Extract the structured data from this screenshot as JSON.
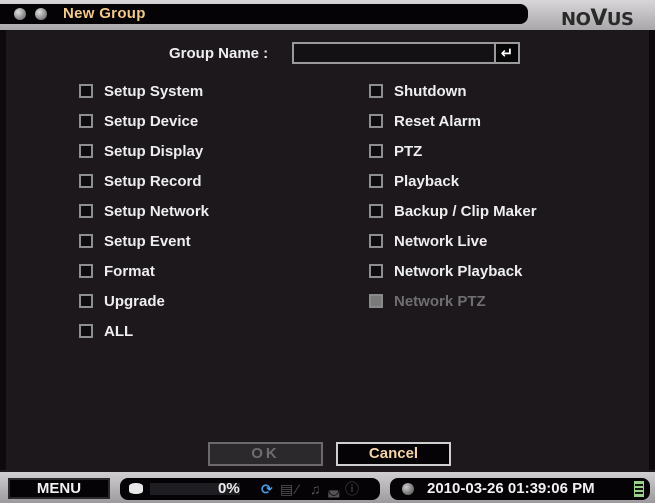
{
  "window": {
    "title": "New Group",
    "brand": "NOVUS"
  },
  "form": {
    "group_name_label": "Group Name :",
    "group_name_value": "",
    "enter_symbol": "↵"
  },
  "permissions": {
    "left": [
      {
        "label": "Setup System",
        "checked": false,
        "enabled": true
      },
      {
        "label": "Setup Device",
        "checked": false,
        "enabled": true
      },
      {
        "label": "Setup Display",
        "checked": false,
        "enabled": true
      },
      {
        "label": "Setup Record",
        "checked": false,
        "enabled": true
      },
      {
        "label": "Setup Network",
        "checked": false,
        "enabled": true
      },
      {
        "label": "Setup Event",
        "checked": false,
        "enabled": true
      },
      {
        "label": "Format",
        "checked": false,
        "enabled": true
      },
      {
        "label": "Upgrade",
        "checked": false,
        "enabled": true
      },
      {
        "label": "ALL",
        "checked": false,
        "enabled": true
      }
    ],
    "right": [
      {
        "label": "Shutdown",
        "checked": false,
        "enabled": true
      },
      {
        "label": "Reset Alarm",
        "checked": false,
        "enabled": true
      },
      {
        "label": "PTZ",
        "checked": false,
        "enabled": true
      },
      {
        "label": "Playback",
        "checked": false,
        "enabled": true
      },
      {
        "label": "Backup / Clip Maker",
        "checked": false,
        "enabled": true
      },
      {
        "label": "Network Live",
        "checked": false,
        "enabled": true
      },
      {
        "label": "Network Playback",
        "checked": false,
        "enabled": true
      },
      {
        "label": "Network PTZ",
        "checked": false,
        "enabled": false
      }
    ]
  },
  "buttons": {
    "ok": "OK",
    "cancel": "Cancel"
  },
  "statusbar": {
    "menu": "MENU",
    "hdd_usage_percent": 0,
    "hdd_usage_text": "0%",
    "icons": [
      "hdd-icon",
      "refresh-icon",
      "record-icon",
      "network-off-icon",
      "alarm-bell-icon",
      "storage-icon",
      "warning-icon"
    ],
    "datetime": "2010-03-26 01:39:06 PM",
    "battery": "battery-icon"
  },
  "colors": {
    "title_text": "#f2c98a",
    "cancel_text": "#f3d3a8",
    "background": "#1c181c",
    "refresh_icon": "#4a9be8"
  }
}
